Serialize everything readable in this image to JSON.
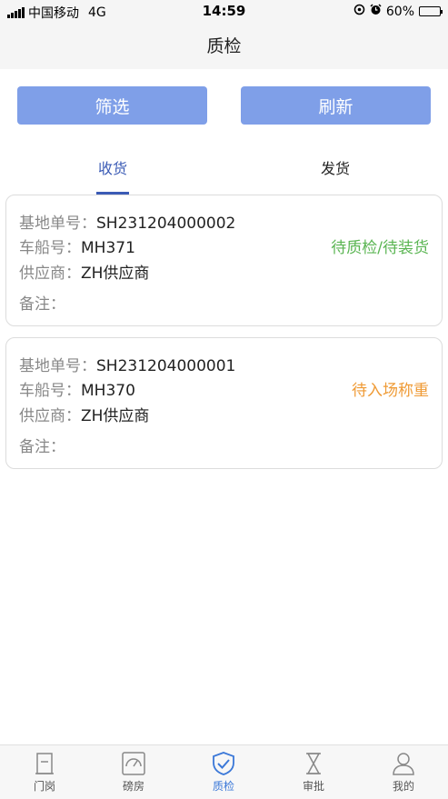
{
  "status_bar": {
    "carrier": "中国移动",
    "network": "4G",
    "time": "14:59",
    "battery": "60%",
    "battery_level": 0.6
  },
  "nav": {
    "title": "质检"
  },
  "actions": {
    "filter_label": "筛选",
    "refresh_label": "刷新"
  },
  "tabs": [
    {
      "label": "收货",
      "active": true
    },
    {
      "label": "发货",
      "active": false
    }
  ],
  "labels": {
    "base_no": "基地单号：",
    "vehicle": "车船号：",
    "supplier": "供应商：",
    "remark": "备注："
  },
  "records": [
    {
      "base_no": "SH231204000002",
      "vehicle": "MH371",
      "supplier": "ZH供应商",
      "remark": "",
      "status": "待质检/待装货",
      "status_color": "#5ab552"
    },
    {
      "base_no": "SH231204000001",
      "vehicle": "MH370",
      "supplier": "ZH供应商",
      "remark": "",
      "status": "待入场称重",
      "status_color": "#ef9a34"
    }
  ],
  "tabbar": [
    {
      "label": "门岗",
      "icon": "gate-icon",
      "active": false
    },
    {
      "label": "磅房",
      "icon": "scale-icon",
      "active": false
    },
    {
      "label": "质检",
      "icon": "shield-check-icon",
      "active": true
    },
    {
      "label": "审批",
      "icon": "hourglass-icon",
      "active": false
    },
    {
      "label": "我的",
      "icon": "user-icon",
      "active": false
    }
  ],
  "colors": {
    "primary": "#7f9fe8",
    "active": "#3b78d8",
    "tab_active": "#3b5bb5"
  }
}
